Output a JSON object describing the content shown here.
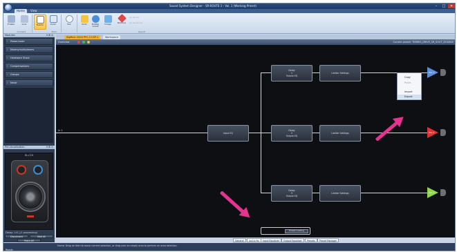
{
  "window": {
    "title": "Sound System Designer - SR-ROUTE-1 - Vol. 1 (Working Preset)",
    "min": "–",
    "max": "□",
    "close": "✕"
  },
  "ribbon_tabs": [
    "Home",
    "View"
  ],
  "ribbon": {
    "buttons": [
      {
        "label": "Enable",
        "icon": "enable-icon"
      },
      {
        "label": "Lock",
        "icon": "lock-icon"
      },
      {
        "label": "Builder",
        "icon": "builder-icon"
      },
      {
        "label": "Zoom",
        "icon": "zoom-icon"
      },
      {
        "label": "Pan",
        "icon": "pan-icon"
      },
      {
        "label": "Undo",
        "icon": "undo-icon"
      },
      {
        "label": "Bubble Cutoff",
        "icon": "bubble-icon"
      },
      {
        "label": "Image",
        "icon": "image-icon"
      },
      {
        "label": "Remove",
        "icon": "remove-icon"
      }
    ],
    "groups": [
      "Connect",
      "Tools",
      "Layout"
    ]
  },
  "left_panel": {
    "modules_title": "Modules",
    "modules_controls": "▾ ⊞ ✕",
    "modules": [
      "Power/node",
      "Mixers/multiplexers",
      "Hardware Stack",
      "Compensations",
      "Groups",
      "Neutr"
    ],
    "preview_title": "Pre-visualization",
    "preview_controls": "▾ ⊞ ✕",
    "preview_device": "SL-C15",
    "delay_text": "Delay: 1.6  |  (1 processing)",
    "buttons": [
      "Disconnect",
      "Mod All",
      "Patch All"
    ]
  },
  "document_tabs": [
    "SigMain 2004 PFC-3 CSP-1",
    "Workspace"
  ],
  "canvas_toolbar": {
    "label": "Overview",
    "dot_colors": [
      "#e04848",
      "#4fb44f",
      "#d7c24a"
    ],
    "preset": "Current preset: TEMMO_DRIVE_SR_SOUT_DOUBLE"
  },
  "canvas": {
    "input_label": "In 2",
    "main_block": "Input EQ",
    "branches": [
      {
        "block": "Delay\n1\nOutput EQ",
        "settings": "Limiter Settings",
        "out_label": "Out 1",
        "color": "#5b8fd9"
      },
      {
        "block": "Delay\n2\nOutput EQ",
        "settings": "Limiter Settings",
        "out_label": "Out 2",
        "color": "#e03232"
      },
      {
        "block": "Delay\n3\nOutput EQ",
        "settings": "Limiter Settings",
        "out_label": "Out 3",
        "color": "#8fd44a"
      }
    ],
    "context_menu": [
      "Copy",
      "Paste",
      "Import",
      "Export"
    ],
    "toggle_label": "Preset Loading"
  },
  "bottom_tabs": [
    "General",
    "Xo/Ltr/Hz",
    "Input Equalizer",
    "Output Equalizer",
    "Presets",
    "Preset Manager"
  ],
  "status": {
    "ready": "Ready",
    "hint": "Home: Drag an item to move current selection, or drag over an empty area to perform an area selection."
  }
}
